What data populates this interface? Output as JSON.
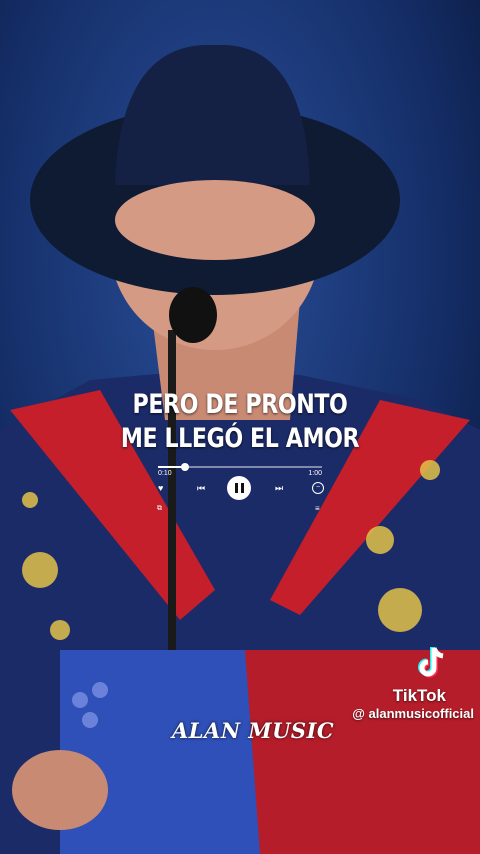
{
  "lyrics": {
    "line1": "PERO DE PRONTO",
    "line2": "ME LLEGÓ EL AMOR"
  },
  "player": {
    "current_time": "0:10",
    "total_time": "1:00",
    "progress": 0.167,
    "icons": [
      "heart-icon",
      "previous-icon",
      "pause-icon",
      "next-icon",
      "more-icon",
      "device-icon",
      "queue-icon"
    ]
  },
  "tiktok": {
    "name": "TikTok",
    "handle": "@ alanmusicofficial"
  },
  "watermark": {
    "text": "ALAN MUSIC"
  },
  "colors": {
    "background": "#0b1a3a",
    "jacket": "#1a2a66",
    "red": "#c41f2b",
    "gold": "#e2c24a"
  }
}
